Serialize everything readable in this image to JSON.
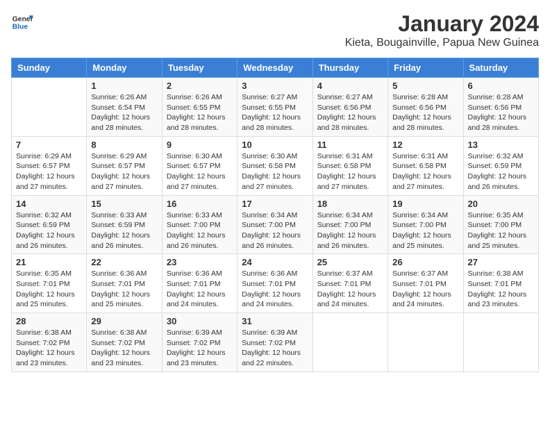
{
  "header": {
    "logo_line1": "General",
    "logo_line2": "Blue",
    "month": "January 2024",
    "location": "Kieta, Bougainville, Papua New Guinea"
  },
  "days_of_week": [
    "Sunday",
    "Monday",
    "Tuesday",
    "Wednesday",
    "Thursday",
    "Friday",
    "Saturday"
  ],
  "weeks": [
    [
      {
        "day": "",
        "sunrise": "",
        "sunset": "",
        "daylight": ""
      },
      {
        "day": "1",
        "sunrise": "Sunrise: 6:26 AM",
        "sunset": "Sunset: 6:54 PM",
        "daylight": "Daylight: 12 hours and 28 minutes."
      },
      {
        "day": "2",
        "sunrise": "Sunrise: 6:26 AM",
        "sunset": "Sunset: 6:55 PM",
        "daylight": "Daylight: 12 hours and 28 minutes."
      },
      {
        "day": "3",
        "sunrise": "Sunrise: 6:27 AM",
        "sunset": "Sunset: 6:55 PM",
        "daylight": "Daylight: 12 hours and 28 minutes."
      },
      {
        "day": "4",
        "sunrise": "Sunrise: 6:27 AM",
        "sunset": "Sunset: 6:56 PM",
        "daylight": "Daylight: 12 hours and 28 minutes."
      },
      {
        "day": "5",
        "sunrise": "Sunrise: 6:28 AM",
        "sunset": "Sunset: 6:56 PM",
        "daylight": "Daylight: 12 hours and 28 minutes."
      },
      {
        "day": "6",
        "sunrise": "Sunrise: 6:28 AM",
        "sunset": "Sunset: 6:56 PM",
        "daylight": "Daylight: 12 hours and 28 minutes."
      }
    ],
    [
      {
        "day": "7",
        "sunrise": "Sunrise: 6:29 AM",
        "sunset": "Sunset: 6:57 PM",
        "daylight": "Daylight: 12 hours and 27 minutes."
      },
      {
        "day": "8",
        "sunrise": "Sunrise: 6:29 AM",
        "sunset": "Sunset: 6:57 PM",
        "daylight": "Daylight: 12 hours and 27 minutes."
      },
      {
        "day": "9",
        "sunrise": "Sunrise: 6:30 AM",
        "sunset": "Sunset: 6:57 PM",
        "daylight": "Daylight: 12 hours and 27 minutes."
      },
      {
        "day": "10",
        "sunrise": "Sunrise: 6:30 AM",
        "sunset": "Sunset: 6:58 PM",
        "daylight": "Daylight: 12 hours and 27 minutes."
      },
      {
        "day": "11",
        "sunrise": "Sunrise: 6:31 AM",
        "sunset": "Sunset: 6:58 PM",
        "daylight": "Daylight: 12 hours and 27 minutes."
      },
      {
        "day": "12",
        "sunrise": "Sunrise: 6:31 AM",
        "sunset": "Sunset: 6:58 PM",
        "daylight": "Daylight: 12 hours and 27 minutes."
      },
      {
        "day": "13",
        "sunrise": "Sunrise: 6:32 AM",
        "sunset": "Sunset: 6:59 PM",
        "daylight": "Daylight: 12 hours and 26 minutes."
      }
    ],
    [
      {
        "day": "14",
        "sunrise": "Sunrise: 6:32 AM",
        "sunset": "Sunset: 6:59 PM",
        "daylight": "Daylight: 12 hours and 26 minutes."
      },
      {
        "day": "15",
        "sunrise": "Sunrise: 6:33 AM",
        "sunset": "Sunset: 6:59 PM",
        "daylight": "Daylight: 12 hours and 26 minutes."
      },
      {
        "day": "16",
        "sunrise": "Sunrise: 6:33 AM",
        "sunset": "Sunset: 7:00 PM",
        "daylight": "Daylight: 12 hours and 26 minutes."
      },
      {
        "day": "17",
        "sunrise": "Sunrise: 6:34 AM",
        "sunset": "Sunset: 7:00 PM",
        "daylight": "Daylight: 12 hours and 26 minutes."
      },
      {
        "day": "18",
        "sunrise": "Sunrise: 6:34 AM",
        "sunset": "Sunset: 7:00 PM",
        "daylight": "Daylight: 12 hours and 26 minutes."
      },
      {
        "day": "19",
        "sunrise": "Sunrise: 6:34 AM",
        "sunset": "Sunset: 7:00 PM",
        "daylight": "Daylight: 12 hours and 25 minutes."
      },
      {
        "day": "20",
        "sunrise": "Sunrise: 6:35 AM",
        "sunset": "Sunset: 7:00 PM",
        "daylight": "Daylight: 12 hours and 25 minutes."
      }
    ],
    [
      {
        "day": "21",
        "sunrise": "Sunrise: 6:35 AM",
        "sunset": "Sunset: 7:01 PM",
        "daylight": "Daylight: 12 hours and 25 minutes."
      },
      {
        "day": "22",
        "sunrise": "Sunrise: 6:36 AM",
        "sunset": "Sunset: 7:01 PM",
        "daylight": "Daylight: 12 hours and 25 minutes."
      },
      {
        "day": "23",
        "sunrise": "Sunrise: 6:36 AM",
        "sunset": "Sunset: 7:01 PM",
        "daylight": "Daylight: 12 hours and 24 minutes."
      },
      {
        "day": "24",
        "sunrise": "Sunrise: 6:36 AM",
        "sunset": "Sunset: 7:01 PM",
        "daylight": "Daylight: 12 hours and 24 minutes."
      },
      {
        "day": "25",
        "sunrise": "Sunrise: 6:37 AM",
        "sunset": "Sunset: 7:01 PM",
        "daylight": "Daylight: 12 hours and 24 minutes."
      },
      {
        "day": "26",
        "sunrise": "Sunrise: 6:37 AM",
        "sunset": "Sunset: 7:01 PM",
        "daylight": "Daylight: 12 hours and 24 minutes."
      },
      {
        "day": "27",
        "sunrise": "Sunrise: 6:38 AM",
        "sunset": "Sunset: 7:01 PM",
        "daylight": "Daylight: 12 hours and 23 minutes."
      }
    ],
    [
      {
        "day": "28",
        "sunrise": "Sunrise: 6:38 AM",
        "sunset": "Sunset: 7:02 PM",
        "daylight": "Daylight: 12 hours and 23 minutes."
      },
      {
        "day": "29",
        "sunrise": "Sunrise: 6:38 AM",
        "sunset": "Sunset: 7:02 PM",
        "daylight": "Daylight: 12 hours and 23 minutes."
      },
      {
        "day": "30",
        "sunrise": "Sunrise: 6:39 AM",
        "sunset": "Sunset: 7:02 PM",
        "daylight": "Daylight: 12 hours and 23 minutes."
      },
      {
        "day": "31",
        "sunrise": "Sunrise: 6:39 AM",
        "sunset": "Sunset: 7:02 PM",
        "daylight": "Daylight: 12 hours and 22 minutes."
      },
      {
        "day": "",
        "sunrise": "",
        "sunset": "",
        "daylight": ""
      },
      {
        "day": "",
        "sunrise": "",
        "sunset": "",
        "daylight": ""
      },
      {
        "day": "",
        "sunrise": "",
        "sunset": "",
        "daylight": ""
      }
    ]
  ]
}
